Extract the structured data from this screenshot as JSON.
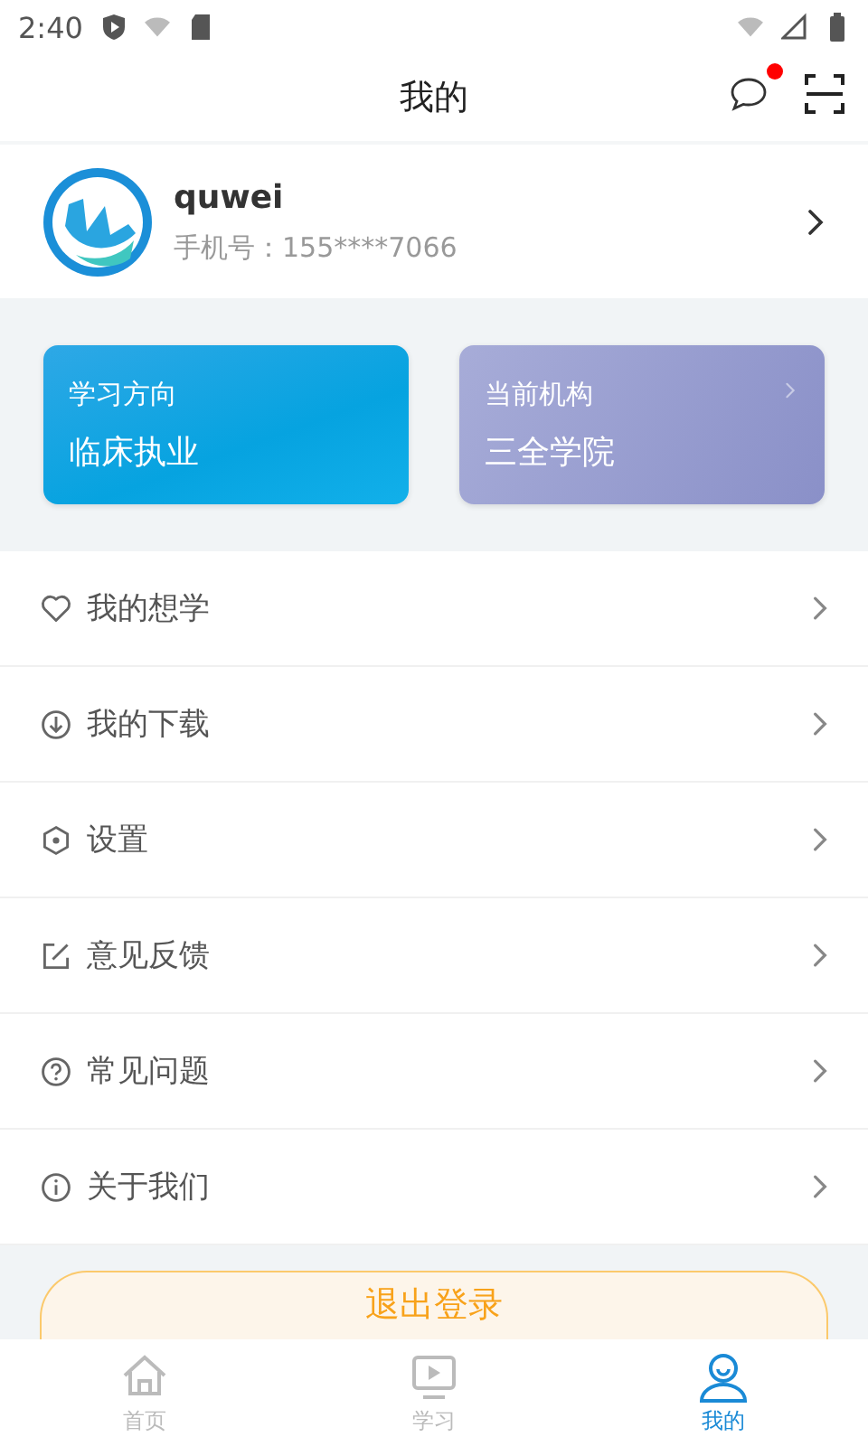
{
  "status_bar": {
    "time": "2:40"
  },
  "header": {
    "title": "我的",
    "message_badge": true
  },
  "profile": {
    "name": "quwei",
    "phone": "手机号：155****7066"
  },
  "cards": [
    {
      "label": "学习方向",
      "value": "临床执业",
      "kind": "blue"
    },
    {
      "label": "当前机构",
      "value": "三全学院",
      "kind": "purple"
    }
  ],
  "menu": [
    {
      "label": "我的想学"
    },
    {
      "label": "我的下载"
    },
    {
      "label": "设置"
    },
    {
      "label": "意见反馈"
    },
    {
      "label": "常见问题"
    },
    {
      "label": "关于我们"
    }
  ],
  "logout_button": "退出登录",
  "tabs": [
    {
      "label": "首页",
      "selected": false
    },
    {
      "label": "学习",
      "selected": false
    },
    {
      "label": "我的",
      "selected": true
    }
  ]
}
